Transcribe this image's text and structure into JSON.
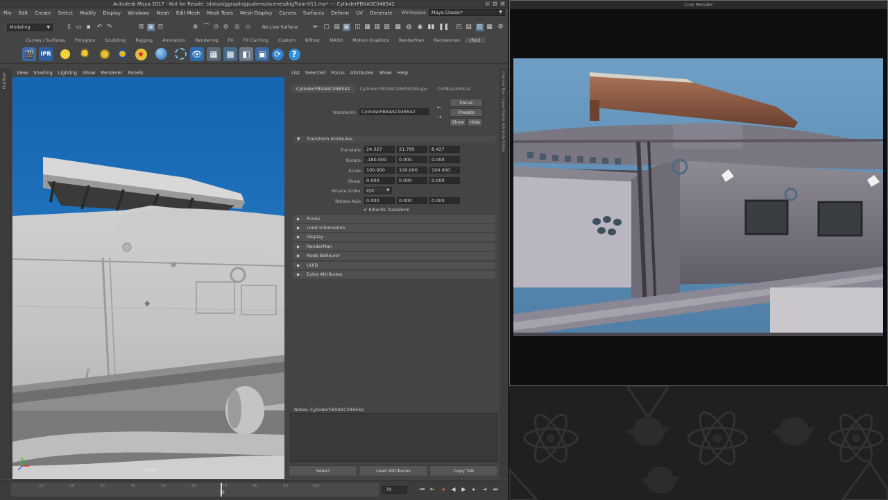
{
  "maya": {
    "title": "Autodesk Maya 2017 - Not for Resale: /data/siggraph/gpudemo/scenes/bigTrain-V11.ma* --- CylinderFBXASC046542",
    "menus": [
      "File",
      "Edit",
      "Create",
      "Select",
      "Modify",
      "Display",
      "Windows",
      "Mesh",
      "Edit Mesh",
      "Mesh Tools",
      "Mesh Display",
      "Curves",
      "Surfaces",
      "Deform",
      "UV",
      "Generate"
    ],
    "workspace_label": "Workspace",
    "workspace_value": "Maya Classic*",
    "mode": "Modeling",
    "live_surface": "No Live Surface",
    "shelf_tabs": [
      "Curves / Surfaces",
      "Polygons",
      "Sculpting",
      "Rigging",
      "Animation",
      "Rendering",
      "FX",
      "FX Caching",
      "Custom",
      "Bifrost",
      "MASH",
      "Motion Graphics",
      "RenderMan",
      "Renderman",
      "rfm2"
    ],
    "shelf_active": "rfm2",
    "shelf_ipr": "IPR"
  },
  "viewport": {
    "menus": [
      "View",
      "Shading",
      "Lighting",
      "Show",
      "Renderer",
      "Panels"
    ],
    "camera": "persp",
    "left_label": "Outliner"
  },
  "attribute_editor": {
    "menus": [
      "List",
      "Selected",
      "Focus",
      "Attributes",
      "Show",
      "Help"
    ],
    "tabs": [
      "CylinderFBXASC046542",
      "CylinderFBXASC046542Shape",
      "CollBlackMetal"
    ],
    "active_tab": "CylinderFBXASC046542",
    "node_type": "transform:",
    "node_name": "CylinderFBXASC046542",
    "buttons": {
      "focus": "Focus",
      "presets": "Presets",
      "show": "Show",
      "hide": "Hide"
    },
    "transform": {
      "header": "Transform Attributes",
      "translate_label": "Translate",
      "translate": [
        "24.327",
        "21.795",
        "8.427"
      ],
      "rotate_label": "Rotate",
      "rotate": [
        "-180.000",
        "0.000",
        "0.000"
      ],
      "scale_label": "Scale",
      "scale": [
        "100.000",
        "100.000",
        "100.000"
      ],
      "shear_label": "Shear",
      "shear": [
        "0.000",
        "0.000",
        "0.000"
      ],
      "rotate_order_label": "Rotate Order",
      "rotate_order": "xyz",
      "rotate_axis_label": "Rotate Axis",
      "rotate_axis": [
        "0.000",
        "0.000",
        "0.000"
      ],
      "inherits": "Inherits Transform"
    },
    "sections": [
      "Pivots",
      "Limit Information",
      "Display",
      "RenderMan",
      "Node Behavior",
      "UUID",
      "Extra Attributes"
    ],
    "notes_label": "Notes: CylinderFBXASC046542",
    "bottom_buttons": [
      "Select",
      "Load Attributes",
      "Copy Tab"
    ],
    "side_label": "Channel Box / Layer Editor   Attribute Editor"
  },
  "timeline": {
    "ticks": [
      "10",
      "20",
      "30",
      "40",
      "50",
      "60",
      "70",
      "80",
      "90",
      "100"
    ],
    "playhead_label": "70",
    "current_frame": "70"
  },
  "live_render": {
    "title": "Live Render"
  }
}
